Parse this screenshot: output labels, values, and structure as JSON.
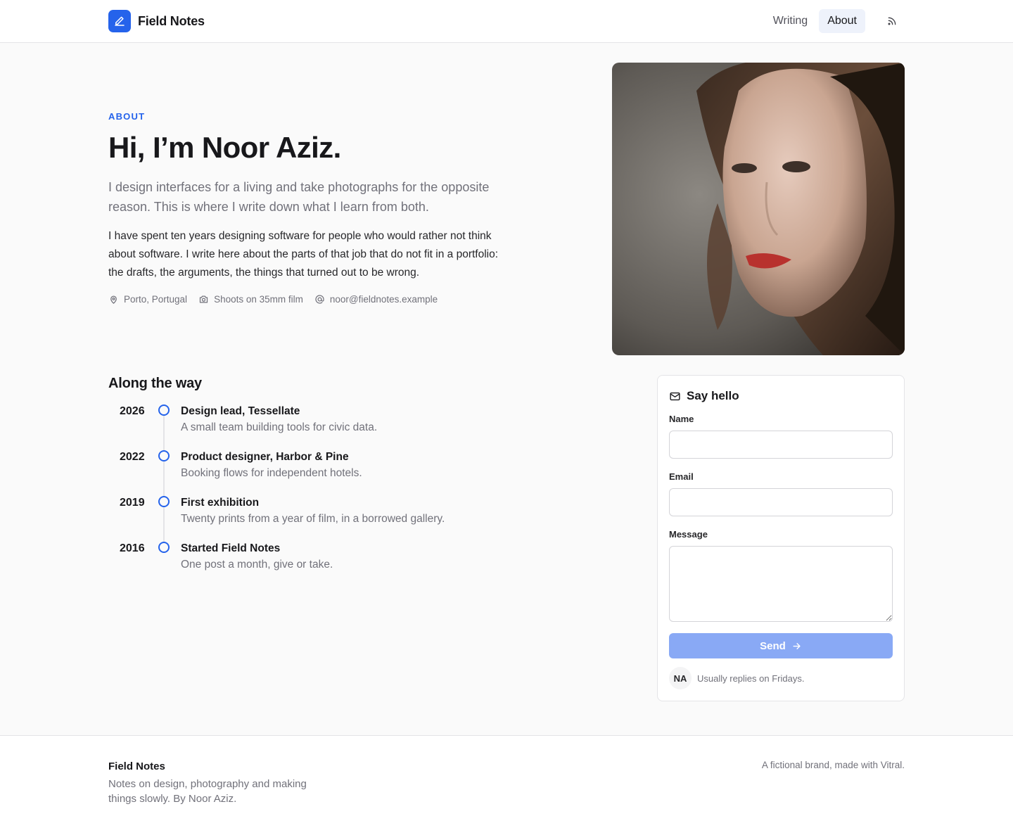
{
  "header": {
    "brand": "Field Notes",
    "nav": [
      {
        "label": "Writing",
        "active": false
      },
      {
        "label": "About",
        "active": true
      }
    ],
    "rss_icon": "rss-icon",
    "accent": "#2563eb"
  },
  "hero": {
    "eyebrow": "ABOUT",
    "title": "Hi, I’m Noor Aziz.",
    "lede": "I design interfaces for a living and take photographs for the opposite reason. This is where I write down what I learn from both.",
    "body": "I have spent ten years designing software for people who would rather not think about software. I write here about the parts of that job that do not fit in a portfolio: the drafts, the arguments, the things that turned out to be wrong.",
    "meta": {
      "location": "Porto, Portugal",
      "camera": "Shoots on 35mm film",
      "email": "noor@fieldnotes.example"
    }
  },
  "timeline": {
    "title": "Along the way",
    "items": [
      {
        "year": "2026",
        "role": "Design lead, Tessellate",
        "desc": "A small team building tools for civic data."
      },
      {
        "year": "2022",
        "role": "Product designer, Harbor & Pine",
        "desc": "Booking flows for independent hotels."
      },
      {
        "year": "2019",
        "role": "First exhibition",
        "desc": "Twenty prints from a year of film, in a borrowed gallery."
      },
      {
        "year": "2016",
        "role": "Started Field Notes",
        "desc": "One post a month, give or take."
      }
    ]
  },
  "contact": {
    "title": "Say hello",
    "name_label": "Name",
    "name_value": "",
    "email_label": "Email",
    "email_value": "",
    "message_label": "Message",
    "message_value": "",
    "send_label": "Send",
    "avatar_initials": "NA",
    "reply_note": "Usually replies on Fridays.",
    "send_color": "#89a9f5"
  },
  "footer": {
    "brand": "Field Notes",
    "desc": "Notes on design, photography and making things slowly. By Noor Aziz.",
    "note": "A fictional brand, made with Vitral."
  }
}
